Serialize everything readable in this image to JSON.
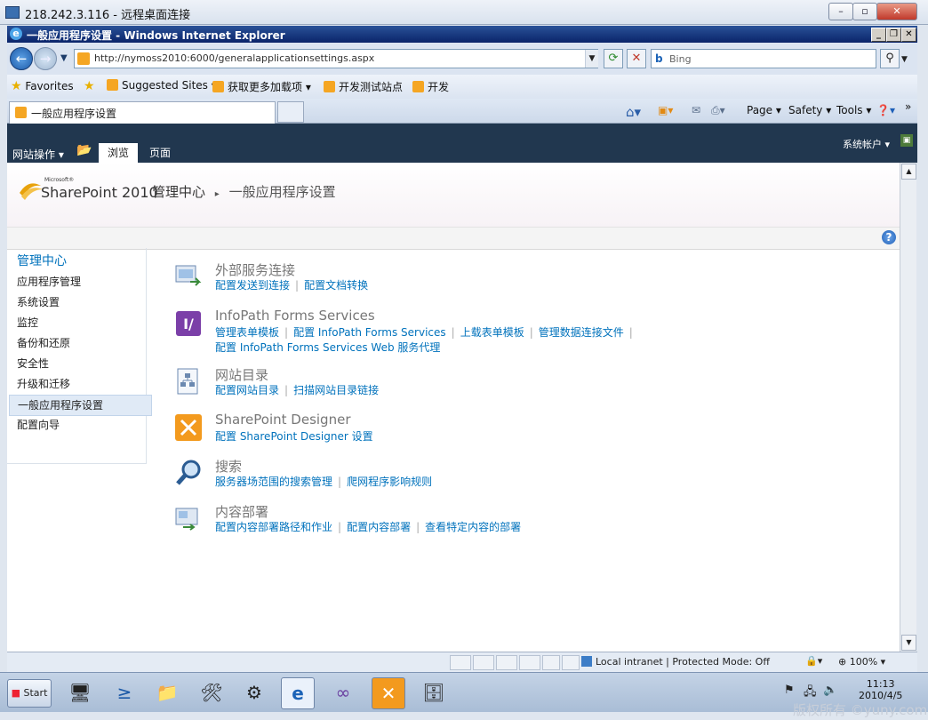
{
  "rdp": {
    "title": "218.242.3.116 - 远程桌面连接"
  },
  "ie": {
    "title": "一般应用程序设置 - Windows Internet Explorer",
    "url": "http://nymoss2010:6000/generalapplicationsettings.aspx",
    "search_placeholder": "Bing",
    "favorites_label": "Favorites",
    "favorites": [
      "Suggested Sites ▾",
      "获取更多加载项 ▾",
      "开发测试站点",
      "开发"
    ],
    "tab_title": "一般应用程序设置",
    "commands": [
      "Page ▾",
      "Safety ▾",
      "Tools ▾"
    ]
  },
  "ribbon": {
    "site_actions": "网站操作 ▾",
    "tabs": [
      "浏览",
      "页面"
    ],
    "account": "系统帐户 ▾"
  },
  "header": {
    "logo": "SharePoint 2010",
    "logo_ms": "Microsoft®",
    "breadcrumb_root": "管理中心",
    "breadcrumb_sep": "▸",
    "breadcrumb_current": "一般应用程序设置"
  },
  "leftnav": [
    "管理中心",
    "应用程序管理",
    "系统设置",
    "监控",
    "备份和还原",
    "安全性",
    "升级和迁移",
    "一般应用程序设置",
    "配置向导"
  ],
  "sections": [
    {
      "title": "外部服务连接",
      "links": [
        "配置发送到连接",
        "配置文档转换"
      ],
      "links2": []
    },
    {
      "title": "InfoPath Forms Services",
      "links": [
        "管理表单模板",
        "配置 InfoPath Forms Services",
        "上载表单模板",
        "管理数据连接文件"
      ],
      "links2": [
        "配置 InfoPath Forms Services Web 服务代理"
      ]
    },
    {
      "title": "网站目录",
      "links": [
        "配置网站目录",
        "扫描网站目录链接"
      ],
      "links2": []
    },
    {
      "title": "SharePoint Designer",
      "links": [
        "配置 SharePoint Designer 设置"
      ],
      "links2": []
    },
    {
      "title": "搜索",
      "links": [
        "服务器场范围的搜索管理",
        "爬网程序影响规则"
      ],
      "links2": []
    },
    {
      "title": "内容部署",
      "links": [
        "配置内容部署路径和作业",
        "配置内容部署",
        "查看特定内容的部署"
      ],
      "links2": []
    }
  ],
  "status": {
    "zone": "Local intranet | Protected Mode: Off",
    "zoom": "100%"
  },
  "taskbar": {
    "start": "Start",
    "time": "11:13",
    "date": "2010/4/5"
  },
  "watermark": "版权所有 ©yuny.com"
}
